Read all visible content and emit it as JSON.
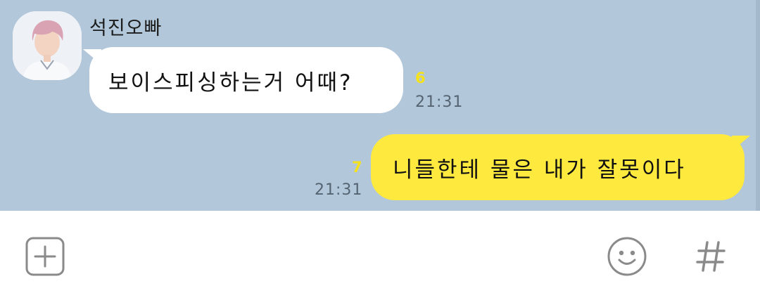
{
  "chat": {
    "contact_name": "석진오빠",
    "messages": [
      {
        "direction": "incoming",
        "text": "보이스피싱하는거 어때?",
        "unread_count": "6",
        "time": "21:31"
      },
      {
        "direction": "outgoing",
        "text": "니들한테 물은 내가 잘못이다",
        "unread_count": "7",
        "time": "21:31"
      }
    ]
  },
  "input_bar": {
    "left_icon": "plus-square-icon",
    "right_icons": [
      "smiley-icon",
      "hash-icon"
    ]
  },
  "colors": {
    "chat_background": "#b2c7da",
    "incoming_bubble": "#ffffff",
    "outgoing_bubble": "#fee93f",
    "unread_count": "#f5e21a",
    "timestamp": "#556472",
    "icon_gray": "#8a8a8a"
  }
}
